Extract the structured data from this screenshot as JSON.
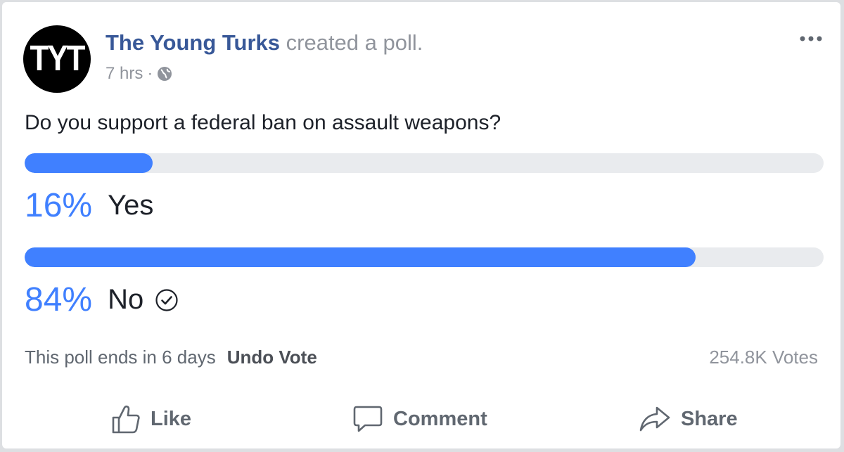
{
  "post": {
    "avatar_text": "TYT",
    "author": "The Young Turks",
    "action": "created a poll.",
    "time": "7 hrs",
    "separator": "·",
    "privacy_icon": "globe-icon",
    "more_icon": "more-options-icon"
  },
  "poll": {
    "question": "Do you support a federal ban on assault weapons?",
    "options": [
      {
        "percent": 16,
        "percent_label": "16%",
        "label": "Yes",
        "selected": false
      },
      {
        "percent": 84,
        "percent_label": "84%",
        "label": "No",
        "selected": true
      }
    ],
    "ends_text": "This poll ends in 6 days",
    "undo_label": "Undo Vote",
    "votes_text": "254.8K Votes"
  },
  "actions": {
    "like_label": "Like",
    "comment_label": "Comment",
    "share_label": "Share"
  },
  "colors": {
    "accent": "#4080ff",
    "author": "#385898",
    "track": "#e9ebee",
    "muted": "#90949c"
  }
}
